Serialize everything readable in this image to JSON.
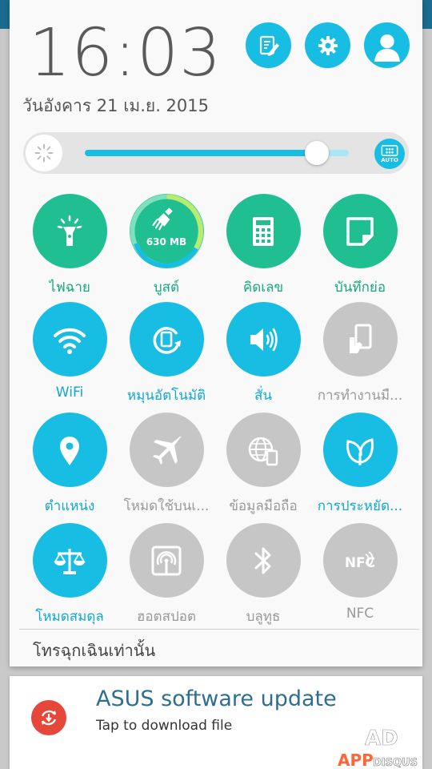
{
  "header": {
    "time": "16:03",
    "date": "วันอังคาร 21 เม.ย. 2015",
    "buttons": [
      {
        "icon": "edit-icon"
      },
      {
        "icon": "gear-icon"
      },
      {
        "icon": "user-avatar-icon"
      }
    ]
  },
  "brightness": {
    "level_fraction": 0.88,
    "auto_label": "AUTO"
  },
  "tiles": [
    {
      "label": "ไฟฉาย",
      "icon": "flashlight-icon",
      "state": "green"
    },
    {
      "label": "บูสต์",
      "icon": "boost-broom-icon",
      "state": "green",
      "badge": "630 MB"
    },
    {
      "label": "คิดเลข",
      "icon": "calculator-icon",
      "state": "green"
    },
    {
      "label": "บันทึกย่อ",
      "icon": "quick-memo-icon",
      "state": "green"
    },
    {
      "label": "WiFi",
      "icon": "wifi-icon",
      "state": "blue"
    },
    {
      "label": "หมุนอัตโนมัติ",
      "icon": "auto-rotate-icon",
      "state": "blue"
    },
    {
      "label": "สั่น",
      "icon": "vibrate-icon",
      "state": "blue"
    },
    {
      "label": "การทำงานมื...",
      "icon": "one-hand-icon",
      "state": "gray"
    },
    {
      "label": "ตำแหน่ง",
      "icon": "location-pin-icon",
      "state": "blue"
    },
    {
      "label": "โหมดใช้บนเ...",
      "icon": "airplane-icon",
      "state": "gray"
    },
    {
      "label": "ข้อมูลมือถือ",
      "icon": "mobile-data-icon",
      "state": "gray"
    },
    {
      "label": "การประหยัด...",
      "icon": "power-saving-leaf-icon",
      "state": "blue"
    },
    {
      "label": "โหมดสมดุล",
      "icon": "balance-scale-icon",
      "state": "blue"
    },
    {
      "label": "ฮอตสปอต",
      "icon": "hotspot-icon",
      "state": "gray"
    },
    {
      "label": "บลูทูธ",
      "icon": "bluetooth-icon",
      "state": "gray"
    },
    {
      "label": "NFC",
      "icon": "nfc-icon",
      "state": "gray"
    }
  ],
  "emergency_text": "โทรฉุกเฉินเท่านั้น",
  "notification": {
    "title": "ASUS software update",
    "subtitle": "Tap to download file",
    "icon": "update-icon"
  },
  "watermark": {
    "text": "APPDISQUS"
  },
  "colors": {
    "accent_blue": "#18bde3",
    "accent_green": "#1fbf92",
    "inactive_gray": "#c6c6c6",
    "notification_red": "#e5483b"
  }
}
